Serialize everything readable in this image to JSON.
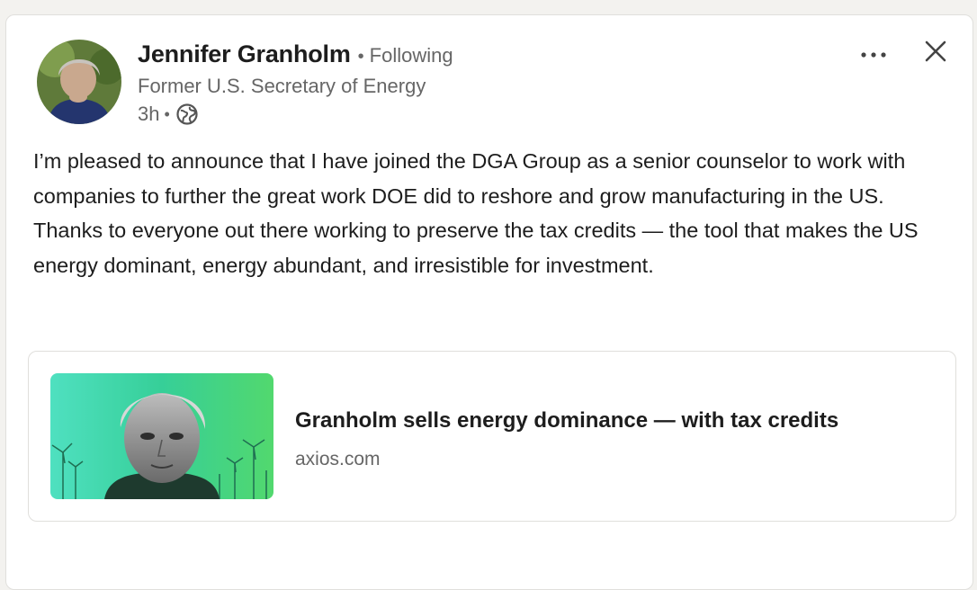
{
  "post": {
    "author": {
      "name": "Jennifer Granholm",
      "follow_status": "Following",
      "headline": "Former U.S. Secretary of Energy",
      "time": "3h",
      "visibility_icon": "globe-icon"
    },
    "controls": {
      "more_icon": "more-horizontal-icon",
      "close_icon": "close-icon"
    },
    "body": "I’m pleased to announce that I have joined the DGA Group as a senior counselor to work with companies to further the great work DOE did to reshore and grow manufacturing in the US. Thanks to everyone out there working to preserve the tax credits — the tool that makes the US energy dominant, energy abundant, and irresistible for investment.",
    "link_preview": {
      "title": "Granholm sells energy dominance — with tax credits",
      "source": "axios.com"
    }
  },
  "colors": {
    "page_background": "#f3f2ef",
    "card_background": "#ffffff",
    "primary_text": "#1d1d1d",
    "secondary_text": "#666666",
    "thumbnail_green": "#3dd49a"
  }
}
